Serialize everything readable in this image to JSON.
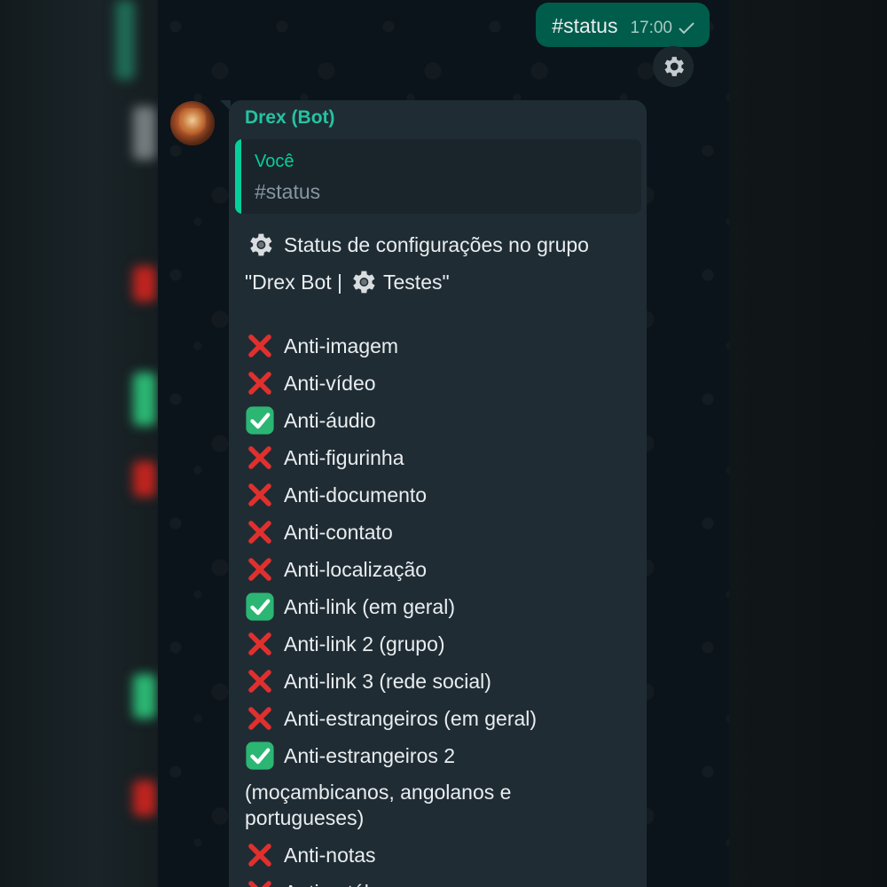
{
  "outgoing": {
    "text": "#status",
    "time": "17:00"
  },
  "incoming": {
    "sender": "Drex (Bot)",
    "quote_author": "Você",
    "quote_text": "#status",
    "title_line1": "Status de configurações no grupo",
    "title_line2_start": "\"Drex Bot |",
    "title_line2_end": "Testes\"",
    "items": [
      {
        "label": "Anti-imagem",
        "enabled": false
      },
      {
        "label": "Anti-vídeo",
        "enabled": false
      },
      {
        "label": "Anti-áudio",
        "enabled": true
      },
      {
        "label": "Anti-figurinha",
        "enabled": false
      },
      {
        "label": "Anti-documento",
        "enabled": false
      },
      {
        "label": "Anti-contato",
        "enabled": false
      },
      {
        "label": "Anti-localização",
        "enabled": false
      },
      {
        "label": "Anti-link (em geral)",
        "enabled": true
      },
      {
        "label": "Anti-link 2 (grupo)",
        "enabled": false
      },
      {
        "label": "Anti-link 3 (rede social)",
        "enabled": false
      },
      {
        "label": "Anti-estrangeiros (em geral)",
        "enabled": false
      },
      {
        "label": "Anti-estrangeiros 2",
        "enabled": true
      },
      {
        "label": "Anti-notas",
        "enabled": false
      },
      {
        "label": "Anti-catálogo",
        "enabled": false
      }
    ],
    "item12_continuation": "(moçambicanos, angolanos e portugueses)"
  },
  "colors": {
    "outgoing_bubble": "#005c4b",
    "incoming_bubble": "#1f2c34",
    "accent": "#25c3a2",
    "cross": "#e0302e",
    "check_box": "#2bb673"
  },
  "icons": [
    "gear-icon",
    "check-icon",
    "cross-mark-icon",
    "check-box-icon"
  ]
}
